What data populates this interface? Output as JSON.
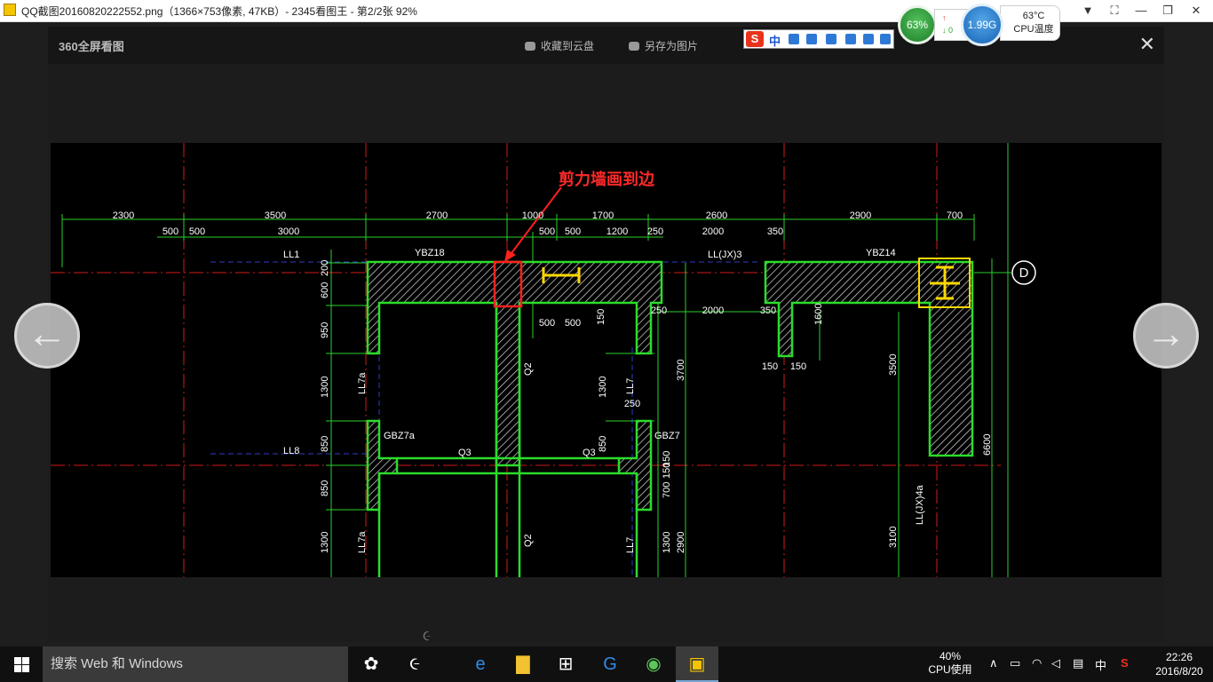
{
  "window": {
    "title": "QQ截图20160820222552.png（1366×753像素, 47KB）- 2345看图王 - 第2/2张 92%",
    "controls": [
      "▼",
      "⛶",
      "—",
      "❐",
      "✕"
    ]
  },
  "floaters": {
    "memory_percent": "63%",
    "net_up": "↑",
    "net_down": "↓ 0",
    "cpu_freq": "1.99G",
    "cpu_temp": "63°C",
    "cpu_temp_label": "CPU温度"
  },
  "viewer": {
    "logo": "360全屏看图",
    "save_cloud": "收藏到云盘",
    "save_as": "另存为图片",
    "close": "✕",
    "prev_arrow": "←",
    "next_arrow": "→",
    "loading": "૯"
  },
  "ime_bar": {
    "logo": "S",
    "lang": "中"
  },
  "drawing": {
    "annotation": "剪力墙画到边",
    "top_dims": [
      "2300",
      "3500",
      "2700",
      "1000",
      "1700",
      "2600",
      "2900",
      "700"
    ],
    "second_dims": [
      "500",
      "500",
      "3000",
      "500",
      "500",
      "1200",
      "250",
      "2000",
      "350"
    ],
    "labels": {
      "ll1": "LL1",
      "ybz18": "YBZ18",
      "lljx3": "LL(JX)3",
      "ybz14": "YBZ14",
      "axis_d": "D",
      "ll7a_1": "LL7a",
      "ll7_1": "LL7",
      "ll8": "LL8",
      "gbz7a": "GBZ7a",
      "gbz7": "GBZ7",
      "q3_1": "Q3",
      "q3_2": "Q3",
      "q2_1": "Q2",
      "q2_2": "Q2",
      "ll7a_2": "LL7a",
      "ll7_2": "LL7",
      "lljx4a": "LL(JX)4a"
    },
    "inner_dims": {
      "d500a": "500",
      "d500b": "500",
      "d150": "150",
      "d250a": "250",
      "d2000": "2000",
      "d350": "350",
      "d1600": "1600",
      "d150a": "150",
      "d150b": "150",
      "d3700": "3700",
      "d3500": "3500",
      "d1300a": "1300",
      "d250b": "250",
      "d850a": "850",
      "d850b": "850",
      "d150c": "150",
      "d700": "700",
      "d150d": "150",
      "d6600": "6600",
      "d1300b": "1300",
      "d2900": "2900",
      "d3100": "3100"
    },
    "left_dims": [
      "200",
      "600",
      "950",
      "1300",
      "850",
      "850",
      "1300"
    ]
  },
  "taskbar": {
    "search_placeholder": "搜索 Web 和 Windows",
    "cpu_percent": "40%",
    "cpu_label": "CPU使用",
    "tray_lang": "中",
    "tray_ime": "S",
    "time": "22:26",
    "date": "2016/8/20"
  }
}
